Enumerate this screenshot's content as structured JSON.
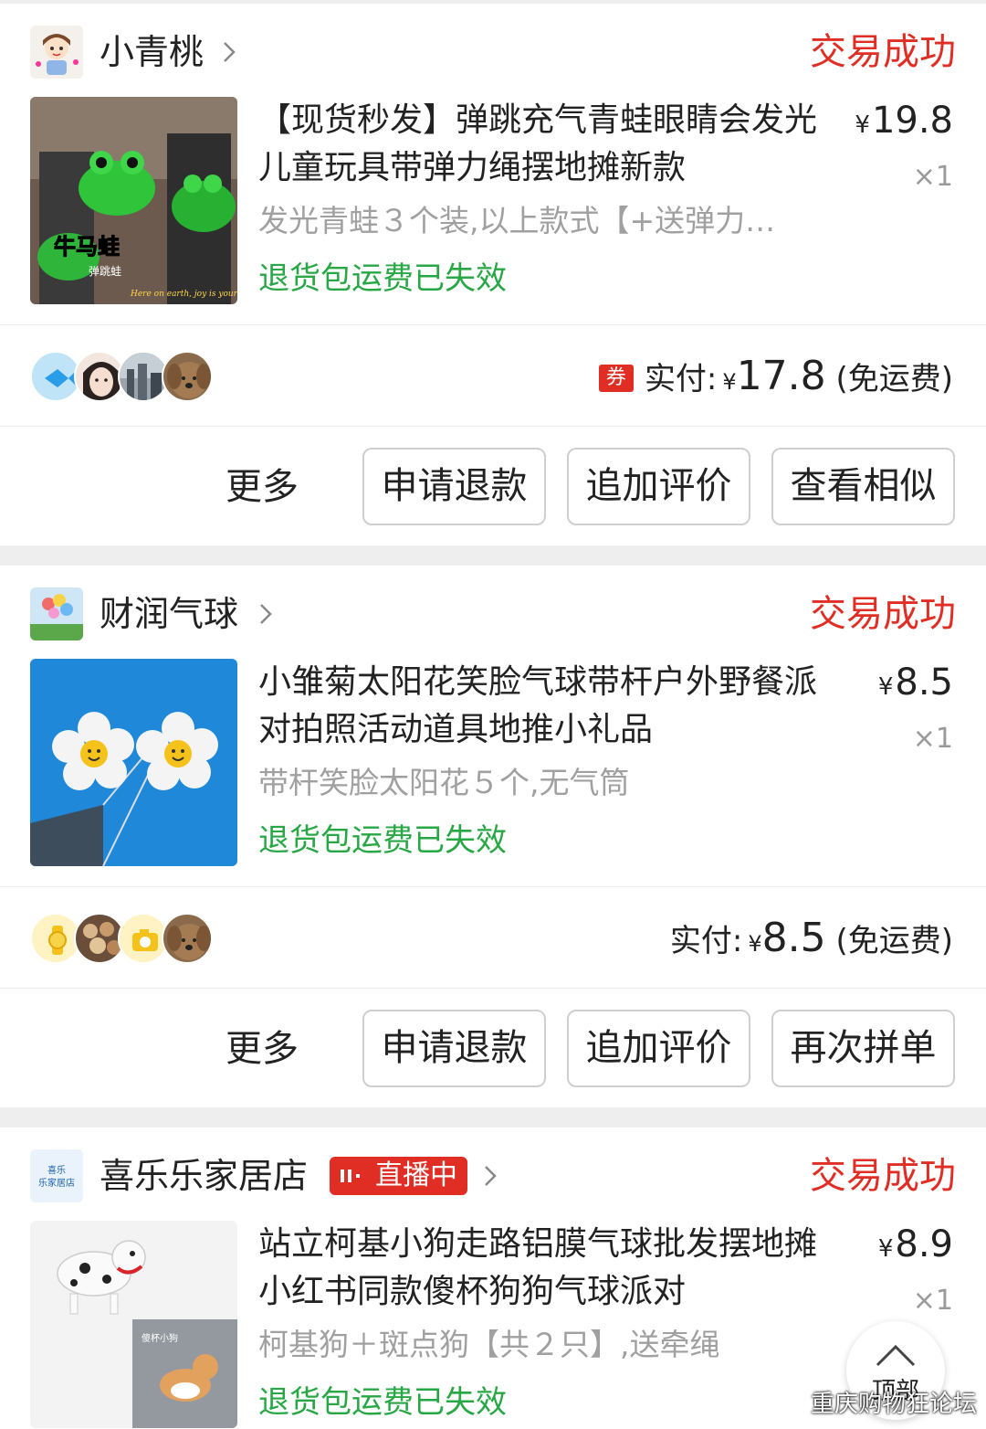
{
  "orders": [
    {
      "shop_name": "小青桃",
      "status": "交易成功",
      "title": "【现货秒发】弹跳充气青蛙眼睛会发光儿童玩具带弹力绳摆地摊新款",
      "spec": "发光青蛙３个装,以上款式【+送弹力…",
      "refund_note": "退货包运费已失效",
      "price_yen": "¥",
      "price": "19.8",
      "qty": "×1",
      "thumb_text_big": "牛马蛙",
      "thumb_text_small": "弹跳蛙",
      "thumb_caption": "Here on earth, joy is yours",
      "coupon": "券",
      "paid_label": "实付:",
      "paid_yen": "¥",
      "paid_amount": "17.8",
      "shipping_note": "(免运费)",
      "more": "更多",
      "buttons": [
        "申请退款",
        "追加评价",
        "查看相似"
      ]
    },
    {
      "shop_name": "财润气球",
      "status": "交易成功",
      "title": "小雏菊太阳花笑脸气球带杆户外野餐派对拍照活动道具地推小礼品",
      "spec": "带杆笑脸太阳花５个,无气筒",
      "refund_note": "退货包运费已失效",
      "price_yen": "¥",
      "price": "8.5",
      "qty": "×1",
      "paid_label": "实付:",
      "paid_yen": "¥",
      "paid_amount": "8.5",
      "shipping_note": "(免运费)",
      "more": "更多",
      "buttons": [
        "申请退款",
        "追加评价",
        "再次拼单"
      ]
    },
    {
      "shop_name": "喜乐乐家居店",
      "shop_logo_text": "喜乐乐家居店",
      "live_badge": "直播中",
      "status": "交易成功",
      "title": "站立柯基小狗走路铝膜气球批发摆地摊小红书同款傻杯狗狗气球派对",
      "spec": "柯基狗＋斑点狗【共２只】,送牵绳",
      "refund_note": "退货包运费已失效",
      "price_yen": "¥",
      "price": "8.9",
      "qty": "×1",
      "thumb_text": "傻杯小狗"
    }
  ],
  "top_button": "顶部",
  "watermark": "重庆购物狂论坛",
  "colors": {
    "status_red": "#e02e24",
    "refund_green": "#28a745",
    "spec_gray": "#a0a0a0",
    "page_bg": "#eeeeee"
  }
}
